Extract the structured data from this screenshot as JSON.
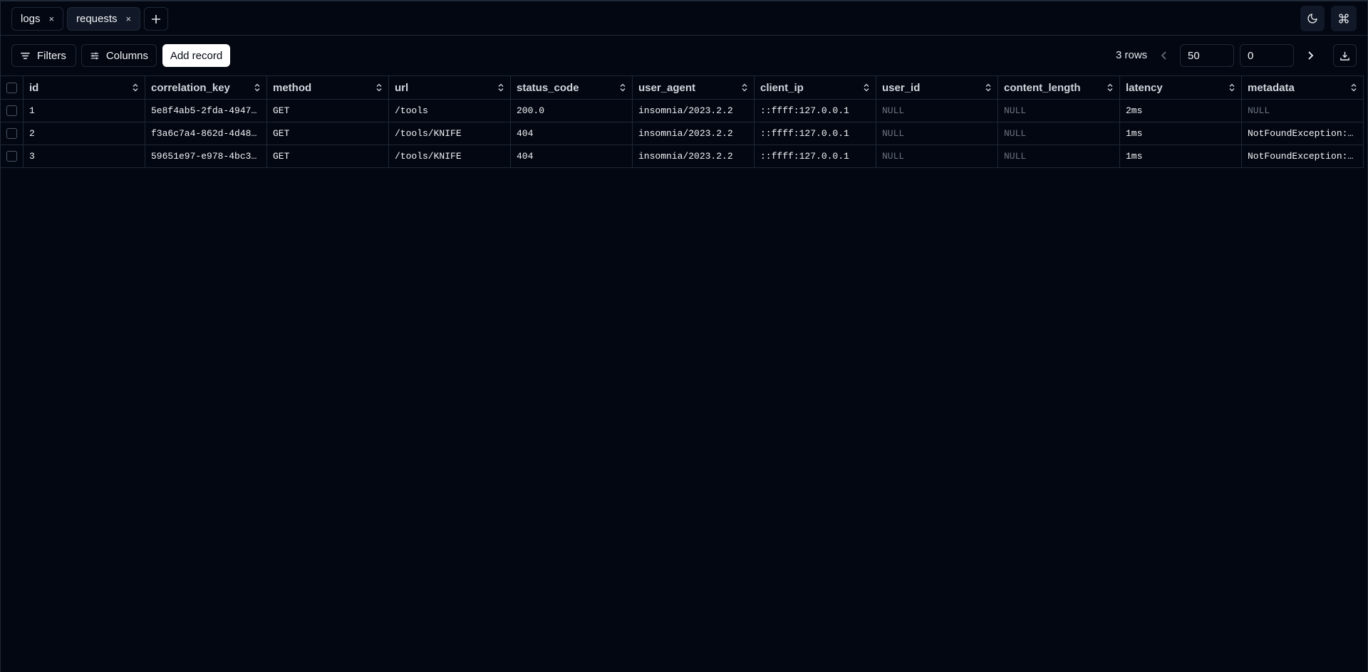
{
  "tabs": [
    {
      "label": "logs",
      "active": false
    },
    {
      "label": "requests",
      "active": true
    }
  ],
  "tab_close_glyph": "×",
  "toolbar": {
    "filters_label": "Filters",
    "columns_label": "Columns",
    "add_record_label": "Add record",
    "rows_count": "3 rows",
    "limit_value": "50",
    "offset_value": "0"
  },
  "icons": {
    "add_tab": "plus-icon",
    "theme": "moon-icon",
    "command": "command-icon",
    "filters": "filter-icon",
    "columns": "sliders-icon",
    "prev": "chevron-left-icon",
    "next": "chevron-right-icon",
    "download": "download-icon",
    "sort": "chevrons-up-down-icon"
  },
  "table": {
    "columns": [
      "id",
      "correlation_key",
      "method",
      "url",
      "status_code",
      "user_agent",
      "client_ip",
      "user_id",
      "content_length",
      "latency",
      "metadata"
    ],
    "rows": [
      [
        "1",
        "5e8f4ab5-2fda-4947-…",
        "GET",
        "/tools",
        "200.0",
        "insomnia/2023.2.2",
        "::ffff:127.0.0.1",
        "NULL",
        "NULL",
        "2ms",
        "NULL"
      ],
      [
        "2",
        "f3a6c7a4-862d-4d48-…",
        "GET",
        "/tools/KNIFE",
        "404",
        "insomnia/2023.2.2",
        "::ffff:127.0.0.1",
        "NULL",
        "NULL",
        "1ms",
        "NotFoundException: …"
      ],
      [
        "3",
        "59651e97-e978-4bc3-…",
        "GET",
        "/tools/KNIFE",
        "404",
        "insomnia/2023.2.2",
        "::ffff:127.0.0.1",
        "NULL",
        "NULL",
        "1ms",
        "NotFoundException: …"
      ]
    ]
  },
  "colors": {
    "background": "#030712",
    "border": "#1f2937",
    "null_text": "#6b7280",
    "primary_button": "#ffffff"
  }
}
